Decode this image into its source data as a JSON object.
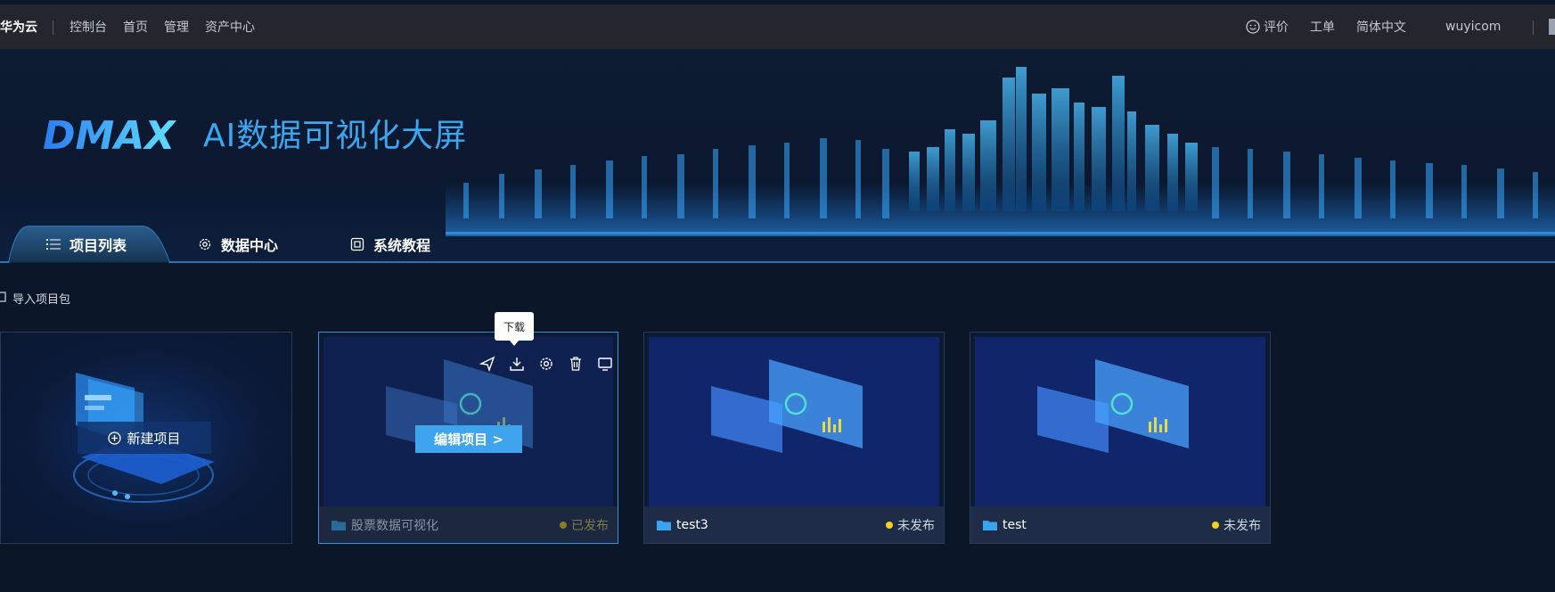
{
  "topbar": {
    "brand": "华为云",
    "nav": [
      "控制台",
      "首页",
      "管理",
      "资产中心"
    ],
    "rate": "评价",
    "ticket": "工单",
    "language": "简体中文",
    "user": "wuyicom"
  },
  "hero": {
    "logo_text": "DMAX",
    "title": "AI数据可视化大屏"
  },
  "tabs": [
    {
      "label": "项目列表",
      "icon": "list-icon",
      "active": true
    },
    {
      "label": "数据中心",
      "icon": "gear-icon",
      "active": false
    },
    {
      "label": "系统教程",
      "icon": "tutorial-icon",
      "active": false
    }
  ],
  "import_label": "导入项目包",
  "new_project": {
    "label": "新建项目"
  },
  "projects": [
    {
      "name": "股票数据可视化",
      "status": "已发布",
      "active": true,
      "edit_label": "编辑项目 >"
    },
    {
      "name": "test3",
      "status": "未发布",
      "active": false
    },
    {
      "name": "test",
      "status": "未发布",
      "active": false
    }
  ],
  "tooltip": "下载",
  "tools": [
    "send-icon",
    "download-icon",
    "settings-icon",
    "delete-icon",
    "preview-icon"
  ],
  "colors": {
    "accent": "#3ea4ee",
    "title": "#3ba7f0",
    "status_dot": "#f2d21c",
    "topbar": "#23262d",
    "background": "#0b1628"
  }
}
